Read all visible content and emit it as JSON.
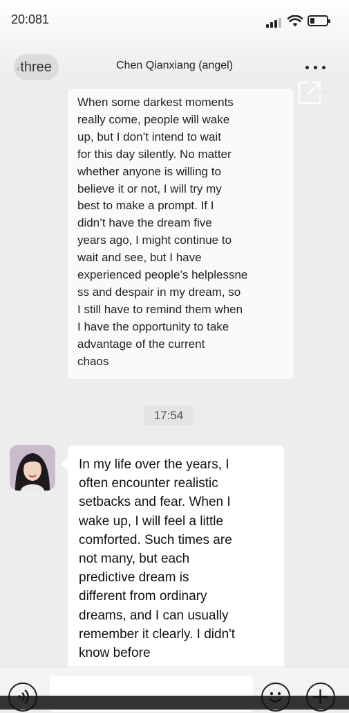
{
  "status_bar": {
    "time": "20:081",
    "icons": [
      "signal-icon",
      "wifi-icon",
      "battery-icon"
    ]
  },
  "nav": {
    "back_label": "three",
    "title": "Chen Qianxiang (angel)",
    "more_icon": "more-dots-icon"
  },
  "share_icon": "external-link-icon",
  "messages": [
    {
      "sender": "self",
      "text": "When some darkest moments\nreally come, people will wake\nup, but I don’t intend to wait\nfor this day silently. No matter\nwhether anyone is willing to\nbelieve it or not, I will try my\nbest to make a prompt. If I\ndidn’t have the dream five\nyears ago, I might continue to\nwait and see, but I have\nexperienced people’s helplessne\nss and despair in my dream, so\nI still have to remind them when\nI have the opportunity to take\nadvantage of the current\nchaos"
    },
    {
      "sender": "contact",
      "text": "In my life over the years, I\noften encounter realistic\nsetbacks and fear. When I\nwake up, I will feel a little\ncomforted. Such times are\nnot many, but each\npredictive dream is\ndifferent from ordinary\ndreams, and I can usually\nremember it clearly. I didn't\nknow before"
    }
  ],
  "timestamp": "17:54",
  "input_bar": {
    "voice_icon": "voice-icon",
    "emoji_icon": "emoji-icon",
    "plus_icon": "plus-icon",
    "input_value": ""
  },
  "colors": {
    "background": "#ededed",
    "bubble": "#ffffff"
  }
}
